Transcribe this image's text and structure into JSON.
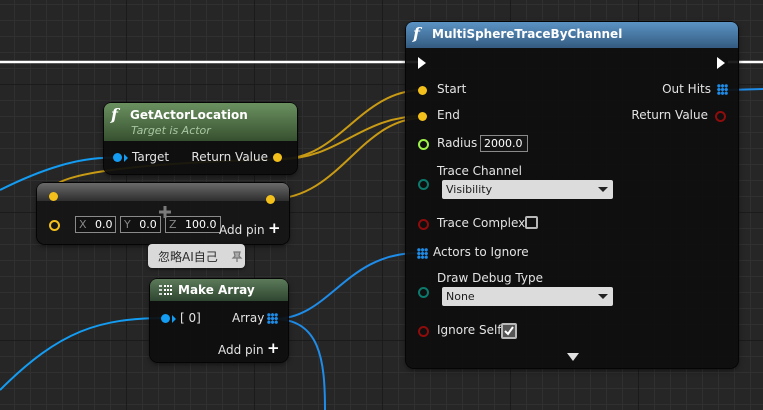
{
  "multi_sphere_trace": {
    "title": "MultiSphereTraceByChannel",
    "start_label": "Start",
    "end_label": "End",
    "radius_label": "Radius",
    "radius_value": "2000.0",
    "trace_channel_label": "Trace Channel",
    "trace_channel_value": "Visibility",
    "trace_complex_label": "Trace Complex",
    "actors_to_ignore_label": "Actors to Ignore",
    "draw_debug_type_label": "Draw Debug Type",
    "draw_debug_type_value": "None",
    "ignore_self_label": "Ignore Self",
    "out_hits_label": "Out Hits",
    "return_value_label": "Return Value",
    "trace_complex_checked": false,
    "ignore_self_checked": true
  },
  "get_actor_location": {
    "title": "GetActorLocation",
    "subtitle": "Target is Actor",
    "target_label": "Target",
    "return_value_label": "Return Value"
  },
  "add_vector_node": {
    "x_label": "X",
    "x_value": "0.0",
    "y_label": "Y",
    "y_value": "0.0",
    "z_label": "Z",
    "z_value": "100.0",
    "add_pin_label": "Add pin",
    "add_pin_icon": "+"
  },
  "comment_bubble": {
    "text": "忽略AI自己"
  },
  "make_array": {
    "title": "Make Array",
    "input_label": "[ 0]",
    "output_label": "Array",
    "add_pin_label": "Add pin",
    "add_pin_icon": "+"
  },
  "colors": {
    "exec": "#ffffff",
    "vector": "#f3c01b",
    "object": "#139cf2",
    "float": "#9cf247",
    "bool": "#8e0c0c",
    "byte": "#076d62",
    "struct": "#1e8ce8",
    "function_header": "#4a7fb0",
    "pure_header": "#4c6b4a"
  }
}
